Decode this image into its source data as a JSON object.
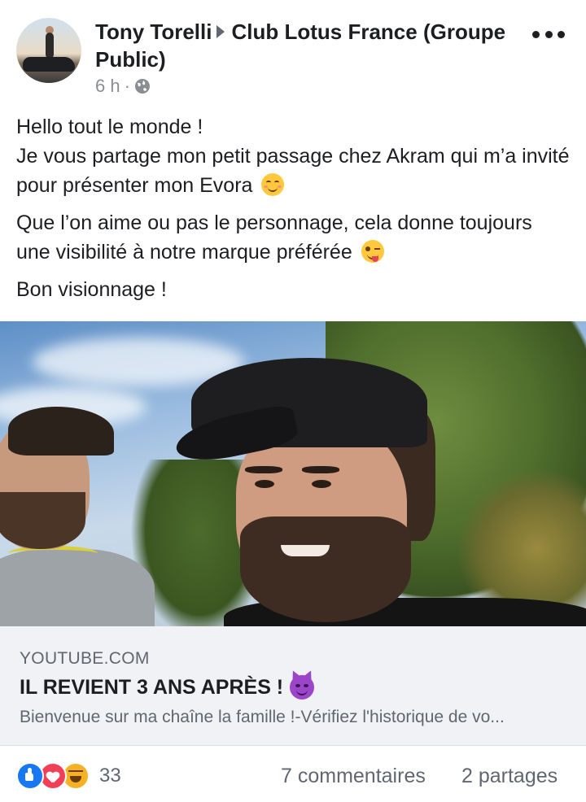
{
  "post": {
    "author": "Tony Torelli",
    "group": "Club Lotus France (Groupe Public)",
    "time": "6 h",
    "privacy_icon": "globe-icon",
    "more_icon": "more-icon",
    "paragraphs": [
      "Hello tout le monde !",
      "Je vous partage mon petit passage chez Akram qui m’a invité pour présenter mon Evora",
      "Que l’on aime ou pas le personnage, cela donne toujours une visibilité à notre marque préférée",
      "Bon visionnage !"
    ]
  },
  "link": {
    "domain": "YOUTUBE.COM",
    "title": "IL REVIENT 3 ANS APRÈS !",
    "description": "Bienvenue sur ma chaîne la famille !-Vérifiez l'historique de vo..."
  },
  "footer": {
    "reaction_icons": [
      "like-icon",
      "love-icon",
      "haha-icon"
    ],
    "reaction_count": "33",
    "comments": "7 commentaires",
    "shares": "2 partages"
  },
  "colors": {
    "text": "#1c1e21",
    "secondary": "#606770",
    "link_bg": "#f0f2f5",
    "like": "#1877f2",
    "love": "#f33e58",
    "haha": "#f7b125"
  }
}
